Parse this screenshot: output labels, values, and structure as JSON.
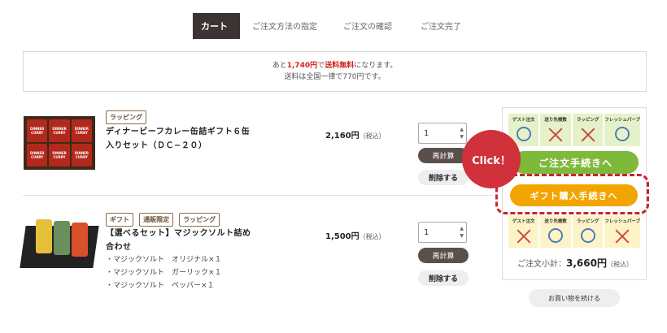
{
  "steps": {
    "cart": "カート",
    "method": "ご注文方法の指定",
    "confirm": "ご注文の確認",
    "complete": "ご注文完了"
  },
  "shipping": {
    "pre": "あと",
    "amount": "1,740円",
    "mid": "で",
    "free": "送料無料",
    "post": "になります。",
    "line2": "送料は全国一律で770円です。"
  },
  "items": [
    {
      "tags": [
        "ラッピング"
      ],
      "name_line1": "ディナービーフカレー缶詰ギフト６缶",
      "name_line2": "入りセット（ＤＣ−２０）",
      "price": "2,160円",
      "tax": "（税込）",
      "qty": "1",
      "recalc": "再計算",
      "delete": "削除する"
    },
    {
      "tags": [
        "ギフト",
        "通販限定",
        "ラッピング"
      ],
      "name_line1": "【選べるセット】マジックソルト詰め",
      "name_line2": "合わせ",
      "sub": [
        "・マジックソルト　オリジナル×１",
        "・マジックソルト　ガーリック×１",
        "・マジックソルト　ペッパー×１"
      ],
      "price": "1,500円",
      "tax": "（税込）",
      "qty": "1",
      "recalc": "再計算",
      "delete": "削除する"
    }
  ],
  "can_label": "DINNER CURRY",
  "options": [
    "ゲスト注文",
    "送り先複数",
    "ラッピング",
    "フレッシュパーブ"
  ],
  "options_top_marks": [
    "circle",
    "cross",
    "cross",
    "circle"
  ],
  "options_bottom_marks": [
    "cross",
    "circle",
    "circle",
    "cross"
  ],
  "buttons": {
    "order": "ご注文手続きへ",
    "gift": "ギフト購入手続きへ",
    "continue": "お買い物を続ける"
  },
  "click_label": "Click！",
  "subtotal": {
    "label": "ご注文小計：",
    "value": "3,660円",
    "tax": "（税込）"
  },
  "colors": {
    "accent_green": "#7eb93a",
    "accent_yellow": "#f2a400",
    "dark": "#3b3432",
    "red": "#d0241e"
  }
}
